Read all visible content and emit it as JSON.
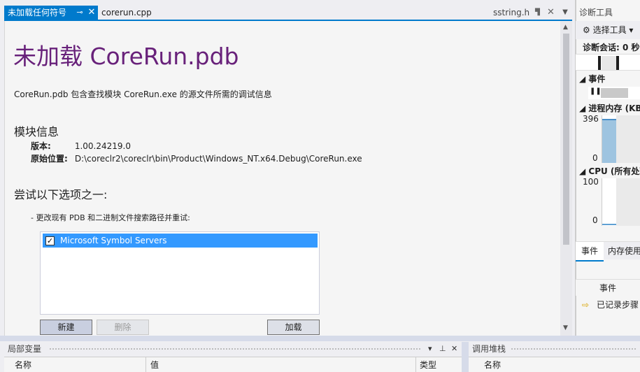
{
  "tabs": {
    "active_label": "未加载任何符号",
    "active_pin": "⊸",
    "active_close": "✕",
    "corerun_label": "corerun.cpp",
    "sstring_label": "sstring.h",
    "sstring_pin": "▜",
    "sstring_close": "✕",
    "overflow": "▼"
  },
  "doc": {
    "title": "未加载 CoreRun.pdb",
    "description": "CoreRun.pdb 包含查找模块 CoreRun.exe 的源文件所需的调试信息",
    "module_section": "模块信息",
    "version_key": "版本:",
    "version_value": "1.00.24219.0",
    "location_key": "原始位置:",
    "location_value": "D:\\coreclr2\\coreclr\\bin\\Product\\Windows_NT.x64.Debug\\CoreRun.exe",
    "try_section": "尝试以下选项之一:",
    "option_1": "-  更改现有 PDB 和二进制文件搜索路径并重试:",
    "symbol_server": "Microsoft Symbol Servers",
    "symbol_checked_glyph": "✓",
    "btn_new": "新建",
    "btn_delete": "删除",
    "btn_load": "加载"
  },
  "locals": {
    "header": "局部变量",
    "ctl_dropdown": "▾",
    "ctl_pin": "⊥",
    "ctl_close": "✕",
    "col_name": "名称",
    "col_value": "值",
    "col_type": "类型"
  },
  "callstack": {
    "header": "调用堆栈",
    "col_name": "名称"
  },
  "diag": {
    "header": "诊断工具",
    "toolbar_label": "⚙ 选择工具 ▾",
    "session": "诊断会话: 0 秒",
    "events_section": "◢ 事件",
    "memory_section": "◢ 进程内存 (KB)",
    "memory_max": "396",
    "memory_min": "0",
    "cpu_section": "◢ CPU (所有处理器)",
    "cpu_max": "100",
    "cpu_min": "0",
    "tab_events": "事件",
    "tab_memory": "内存使用",
    "grid_col_event": "事件",
    "grid_row_label": "已记录步骤",
    "memory_level_fraction": 0.93
  }
}
